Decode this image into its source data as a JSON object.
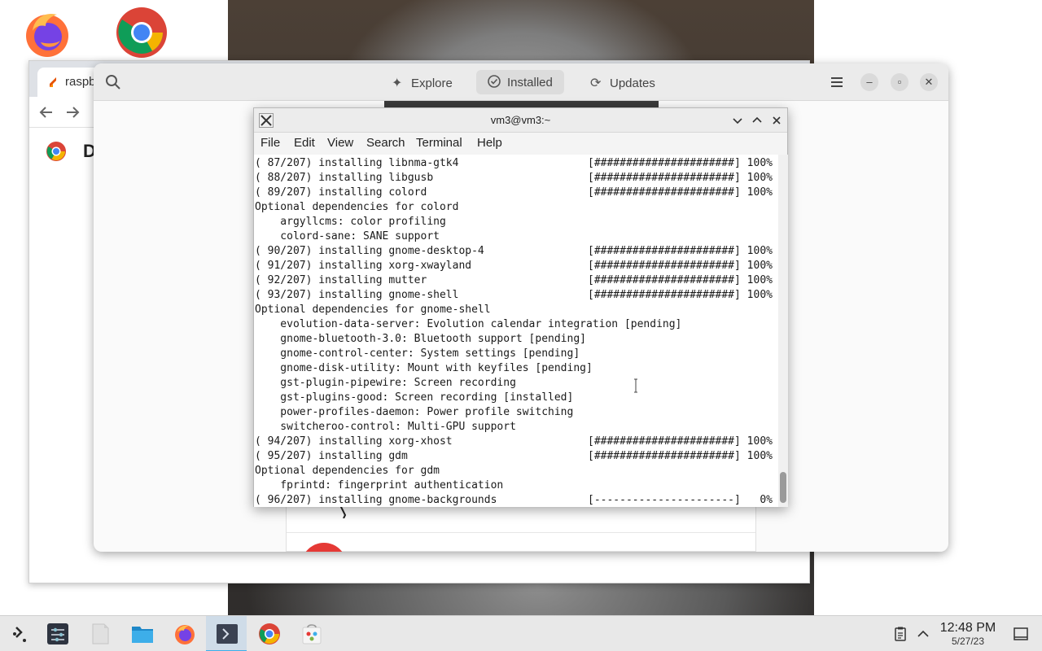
{
  "desktop": {
    "icons": [
      "firefox-icon",
      "chrome-icon"
    ]
  },
  "browser": {
    "tab_title": "raspb",
    "body_letter": "D"
  },
  "software": {
    "tabs": [
      {
        "label": "Explore",
        "icon": "explore-icon"
      },
      {
        "label": "Installed",
        "icon": "installed-check-icon"
      },
      {
        "label": "Updates",
        "icon": "updates-refresh-icon"
      }
    ],
    "active_tab": "Installed"
  },
  "terminal": {
    "title": "vm3@vm3:~",
    "menu": [
      "File",
      "Edit",
      "View",
      "Search",
      "Terminal",
      "Help"
    ],
    "lines": [
      {
        "text": "( 87/207) installing libnma-gtk4",
        "progress": "[######################] 100%"
      },
      {
        "text": "( 88/207) installing libgusb",
        "progress": "[######################] 100%"
      },
      {
        "text": "( 89/207) installing colord",
        "progress": "[######################] 100%"
      },
      {
        "text": "Optional dependencies for colord",
        "progress": ""
      },
      {
        "text": "    argyllcms: color profiling",
        "progress": ""
      },
      {
        "text": "    colord-sane: SANE support",
        "progress": ""
      },
      {
        "text": "( 90/207) installing gnome-desktop-4",
        "progress": "[######################] 100%"
      },
      {
        "text": "( 91/207) installing xorg-xwayland",
        "progress": "[######################] 100%"
      },
      {
        "text": "( 92/207) installing mutter",
        "progress": "[######################] 100%"
      },
      {
        "text": "( 93/207) installing gnome-shell",
        "progress": "[######################] 100%"
      },
      {
        "text": "Optional dependencies for gnome-shell",
        "progress": ""
      },
      {
        "text": "    evolution-data-server: Evolution calendar integration [pending]",
        "progress": ""
      },
      {
        "text": "    gnome-bluetooth-3.0: Bluetooth support [pending]",
        "progress": ""
      },
      {
        "text": "    gnome-control-center: System settings [pending]",
        "progress": ""
      },
      {
        "text": "    gnome-disk-utility: Mount with keyfiles [pending]",
        "progress": ""
      },
      {
        "text": "    gst-plugin-pipewire: Screen recording",
        "progress": ""
      },
      {
        "text": "    gst-plugins-good: Screen recording [installed]",
        "progress": ""
      },
      {
        "text": "    power-profiles-daemon: Power profile switching",
        "progress": ""
      },
      {
        "text": "    switcheroo-control: Multi-GPU support",
        "progress": ""
      },
      {
        "text": "( 94/207) installing xorg-xhost",
        "progress": "[######################] 100%"
      },
      {
        "text": "( 95/207) installing gdm",
        "progress": "[######################] 100%"
      },
      {
        "text": "Optional dependencies for gdm",
        "progress": ""
      },
      {
        "text": "    fprintd: fingerprint authentication",
        "progress": ""
      },
      {
        "text": "( 96/207) installing gnome-backgrounds",
        "progress": "[----------------------]   0%"
      }
    ]
  },
  "taskbar": {
    "items": [
      {
        "name": "application-launcher",
        "icon": "launcher-icon"
      },
      {
        "name": "system-settings",
        "icon": "settings-sliders-icon"
      },
      {
        "name": "blank-document",
        "icon": "document-icon"
      },
      {
        "name": "file-manager",
        "icon": "folder-icon"
      },
      {
        "name": "firefox",
        "icon": "firefox-icon"
      },
      {
        "name": "terminal",
        "icon": "terminal-icon"
      },
      {
        "name": "chrome",
        "icon": "chrome-icon"
      },
      {
        "name": "software-center",
        "icon": "software-store-icon"
      }
    ],
    "active_item": "terminal",
    "clock": {
      "time": "12:48 PM",
      "date": "5/27/23"
    }
  },
  "colors": {
    "accent": "#3daee9",
    "terminal_bg": "#ffffff",
    "taskbar_bg": "#e8e8e8"
  }
}
